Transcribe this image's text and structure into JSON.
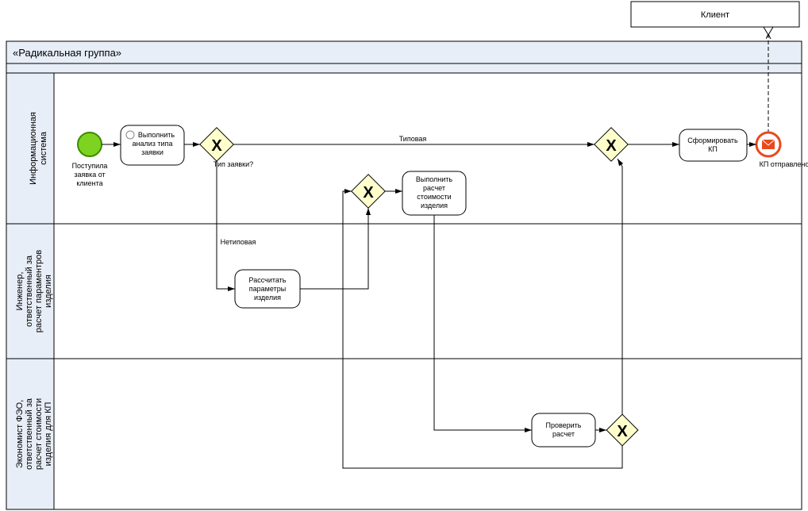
{
  "participant": {
    "label": "Клиент"
  },
  "pool": {
    "title": "«Радикальная группа»"
  },
  "lanes": {
    "lane1": "Информационная система",
    "lane2": "Инженер, ответственный за расчет параментров изделия",
    "lane3": "Экономист ФЭО, ответственный за расчет стоимости изделия для КП"
  },
  "events": {
    "start": "Поступила заявка от клиента",
    "end": "КП отправлено"
  },
  "tasks": {
    "analyze": "Выполнить анализ типа заявки",
    "calcParams": "Рассчитать параметры изделия",
    "calcCost": "Выполнить расчет стоимости изделия",
    "check": "Проверить расчет",
    "formKP": "Сформировать КП"
  },
  "gateways": {
    "g1": "Тип заявки?"
  },
  "flows": {
    "typical": "Типовая",
    "atypical": "Нетиповая"
  }
}
